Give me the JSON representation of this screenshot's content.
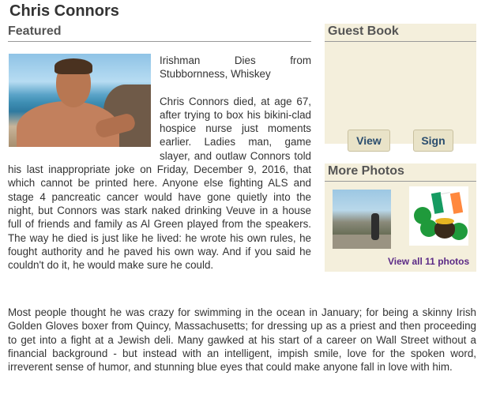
{
  "page": {
    "title": "Chris Connors"
  },
  "featured": {
    "header": "Featured",
    "article_title": "Irishman Dies from Stubbornness, Whiskey",
    "paragraph1": "Chris Connors died, at age 67, after trying to box his bikini-clad hospice nurse just moments earlier. Ladies man, game slayer, and outlaw Connors told his last inappropriate joke on Friday, December 9, 2016, that which cannot be printed here. Anyone else fighting ALS and stage 4 pancreatic cancer would have gone quietly into the night, but Connors was stark naked drinking Veuve in a house full of friends and family as Al Green played from the speakers. The way he died is just like he lived: he wrote his own rules, he fought authority and he paved his own way. And if you said he couldn't do it, he would make sure he could.",
    "paragraph2": "Most people thought he was crazy for swimming in the ocean in January; for being a skinny Irish Golden Gloves boxer from Quincy, Massachusetts; for dressing up as a priest and then proceeding to get into a fight at a Jewish deli. Many gawked at his start of a career on Wall Street without a financial background - but instead with an intelligent, impish smile, love for the spoken word, irreverent sense of humor, and stunning blue eyes that could make anyone fall in love with him."
  },
  "guestbook": {
    "header": "Guest Book",
    "view_label": "View",
    "sign_label": "Sign"
  },
  "more_photos": {
    "header": "More Photos",
    "view_all_prefix": "View all",
    "count": "11",
    "view_all_suffix": "photos"
  },
  "colors": {
    "panel_bg": "#f4efdc",
    "link_purple": "#5b2a86",
    "button_text": "#2a4d6e"
  }
}
